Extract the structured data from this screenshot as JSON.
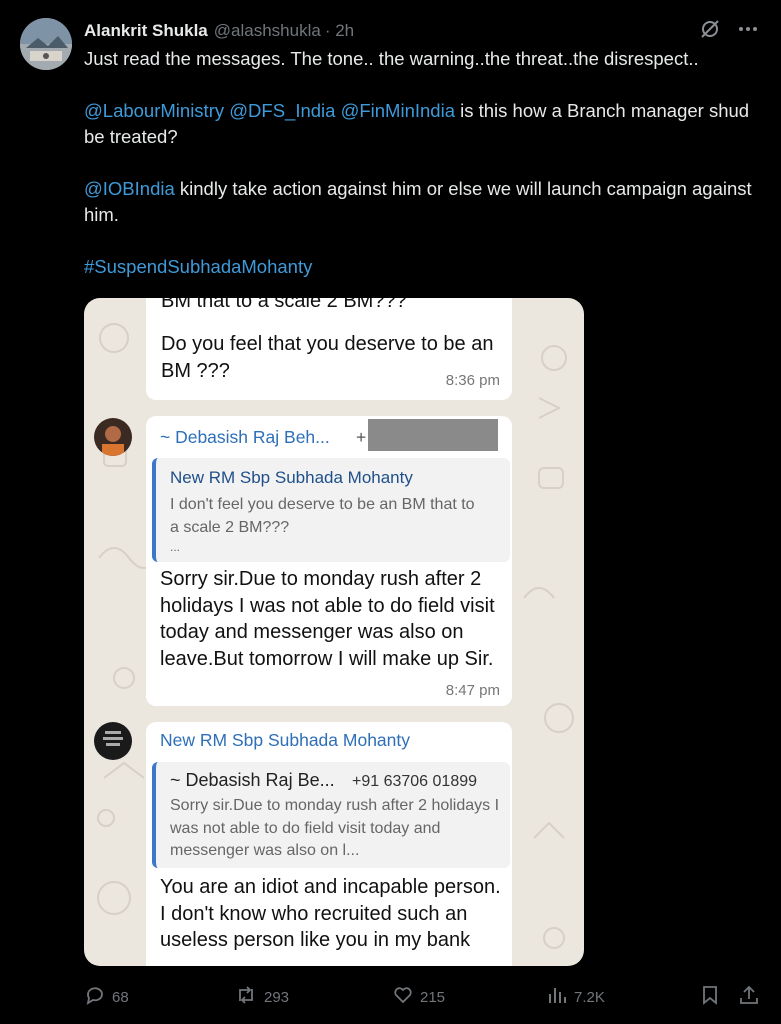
{
  "author": {
    "name": "Alankrit Shukla",
    "handle": "@alashshukla",
    "time": "· 2h"
  },
  "tweet": {
    "line1": "Just read the messages. The tone.. the warning..the threat..the disrespect..",
    "mention_labour": "@LabourMinistry",
    "mention_dfs": "@DFS_India",
    "mention_finmin": "@FinMinIndia",
    "line2_rest": " is this how a Branch manager shud be treated?",
    "mention_iob": "@IOBIndia",
    "line3_rest": " kindly take action against him or else we will launch campaign against him.",
    "hashtag": "#SuspendSubhadaMohanty"
  },
  "screenshot": {
    "msg1_partial": "BM that to a scale 2 BM???",
    "msg1_text": "Do you feel that you deserve to be an BM ???",
    "msg1_time": "8:36 pm",
    "msg2_sender": "~ Debasish Raj Beh...",
    "msg2_plus": "+",
    "msg2_quote_name": "New RM Sbp Subhada Mohanty",
    "msg2_quote_text": "I don't feel you deserve to be an BM that to a scale 2 BM???",
    "msg2_quote_more": "...",
    "msg2_text": "Sorry sir.Due to monday rush after 2 holidays I was not able to do field visit today and messenger was also on leave.But tomorrow I will make up Sir.",
    "msg2_time": "8:47 pm",
    "msg3_sender": "New RM Sbp Subhada Mohanty",
    "msg3_quote_name": "~ Debasish Raj Be...",
    "msg3_quote_phone": "+91 63706 01899",
    "msg3_quote_text": "Sorry sir.Due to monday rush after 2 holidays I was not able to do field visit today and messenger was also on l...",
    "msg3_text": "You are an idiot and incapable person. I don't know who recruited such an useless person like you in my bank"
  },
  "actions": {
    "replies": "68",
    "reposts": "293",
    "likes": "215",
    "views": "7.2K"
  },
  "icons": [
    "grok-icon",
    "more-icon",
    "reply-icon",
    "repost-icon",
    "like-icon",
    "views-icon",
    "bookmark-icon",
    "share-icon"
  ],
  "colors": {
    "link": "#3f9ad9",
    "background": "#000000",
    "muted": "#71767b"
  }
}
